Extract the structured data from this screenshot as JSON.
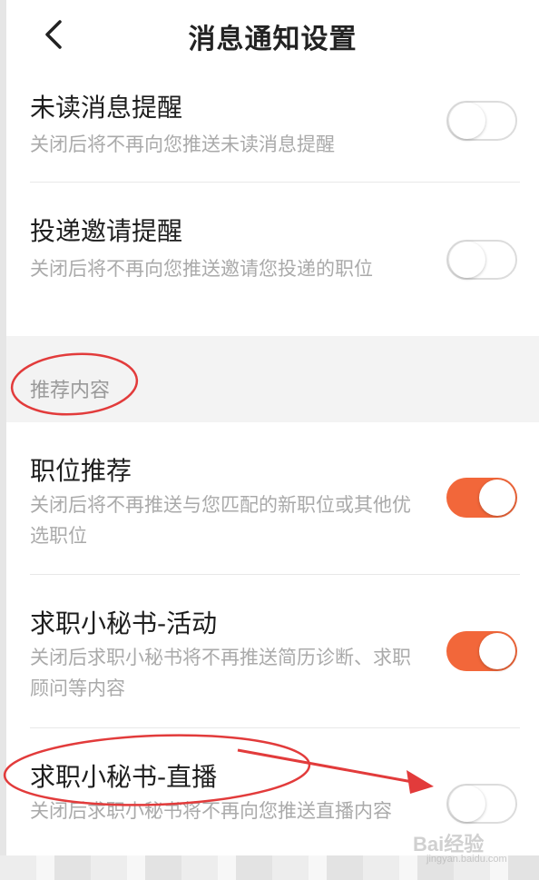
{
  "header": {
    "title": "消息通知设置"
  },
  "items_top": [
    {
      "name": "未读消息提醒",
      "desc": "关闭后将不再向您推送未读消息提醒",
      "on": false
    },
    {
      "name": "投递邀请提醒",
      "desc": "关闭后将不再向您推送邀请您投递的职位",
      "on": false
    }
  ],
  "section": {
    "label": "推荐内容"
  },
  "items_bottom": [
    {
      "name": "职位推荐",
      "desc": "关闭后将不再推送与您匹配的新职位或其他优选职位",
      "on": true
    },
    {
      "name": "求职小秘书-活动",
      "desc": "关闭后求职小秘书将不再推送简历诊断、求职顾问等内容",
      "on": true
    },
    {
      "name": "求职小秘书-直播",
      "desc": "关闭后求职小秘书将不再向您推送直播内容",
      "on": false
    }
  ],
  "watermark": {
    "text": "Bai经验",
    "sub": "jingyan.baidu.com"
  },
  "colors": {
    "accent": "#f2673a",
    "annotation": "#e23b3b"
  }
}
